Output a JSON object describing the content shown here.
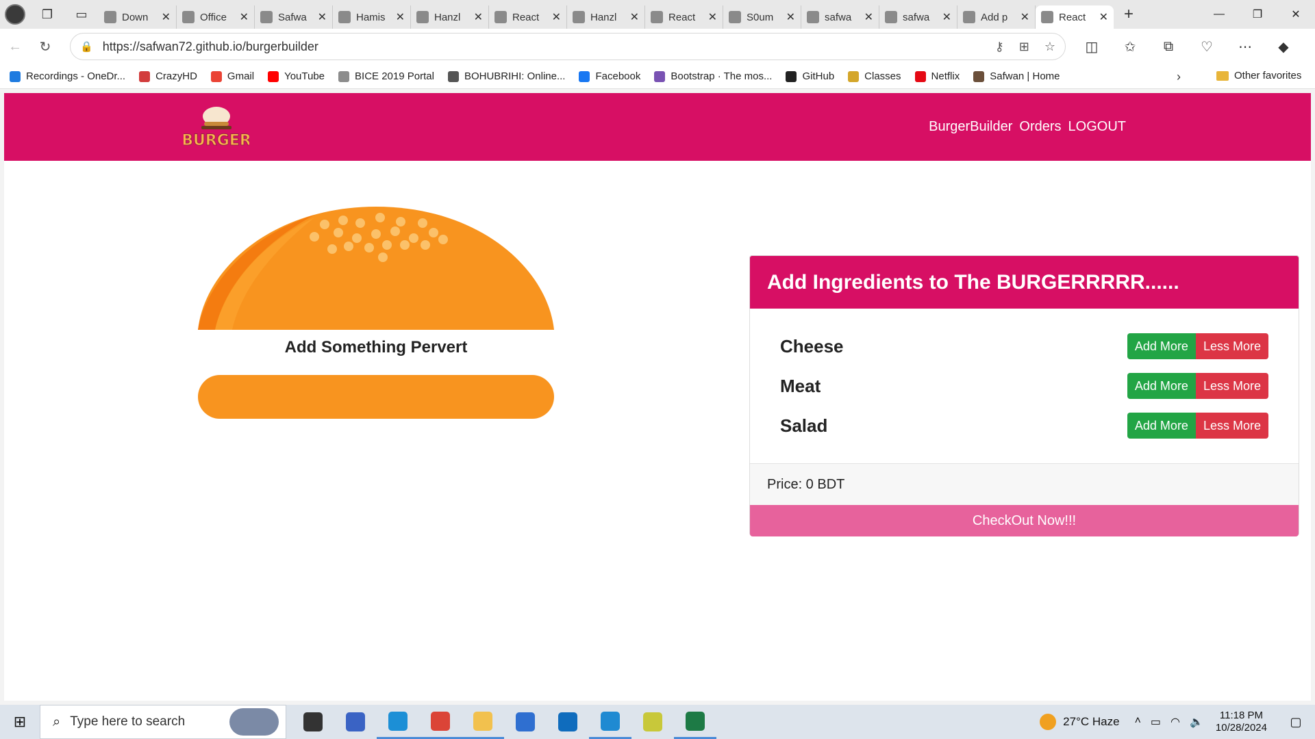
{
  "browser": {
    "tabs": [
      {
        "title": "Down",
        "icon": "gear-icon"
      },
      {
        "title": "Office",
        "icon": "document-icon"
      },
      {
        "title": "Safwa",
        "icon": "avatar-icon"
      },
      {
        "title": "Hamis",
        "icon": "wikipedia-icon"
      },
      {
        "title": "Hanzl",
        "icon": "code-icon"
      },
      {
        "title": "React",
        "icon": "vite-icon"
      },
      {
        "title": "Hanzl",
        "icon": "code-icon"
      },
      {
        "title": "React",
        "icon": "page-icon"
      },
      {
        "title": "S0um",
        "icon": "globe-icon"
      },
      {
        "title": "safwa",
        "icon": "github-icon"
      },
      {
        "title": "safwa",
        "icon": "github-icon"
      },
      {
        "title": "Add p",
        "icon": "page-icon"
      },
      {
        "title": "React",
        "icon": "react-icon",
        "active": true
      }
    ],
    "url": "https://safwan72.github.io/burgerbuilder",
    "bookmarks": [
      {
        "label": "Recordings - OneDr...",
        "color": "#1e7be0"
      },
      {
        "label": "CrazyHD",
        "color": "#d23c3c"
      },
      {
        "label": "Gmail",
        "color": "#ea4335"
      },
      {
        "label": "YouTube",
        "color": "#ff0000"
      },
      {
        "label": "BICE 2019 Portal",
        "color": "#8c8c8c"
      },
      {
        "label": "BOHUBRIHI: Online...",
        "color": "#555555"
      },
      {
        "label": "Facebook",
        "color": "#1877f2"
      },
      {
        "label": "Bootstrap · The mos...",
        "color": "#7952b3"
      },
      {
        "label": "GitHub",
        "color": "#222222"
      },
      {
        "label": "Classes",
        "color": "#d4a62a"
      },
      {
        "label": "Netflix",
        "color": "#e50914"
      },
      {
        "label": "Safwan | Home",
        "color": "#6b4f3a"
      }
    ],
    "other_favorites": "Other favorites"
  },
  "app": {
    "logo_text": "BURGER",
    "nav": [
      "BurgerBuilder",
      "Orders",
      "LOGOUT"
    ],
    "burger_message": "Add Something Pervert",
    "controls": {
      "title": "Add Ingredients to The BURGERRRRR......",
      "ingredients": [
        {
          "name": "Cheese",
          "add": "Add More",
          "less": "Less More"
        },
        {
          "name": "Meat",
          "add": "Add More",
          "less": "Less More"
        },
        {
          "name": "Salad",
          "add": "Add More",
          "less": "Less More"
        }
      ],
      "price": "Price: 0 BDT",
      "checkout": "CheckOut Now!!!"
    },
    "colors": {
      "brand": "#d70f64",
      "bread": "#f8941f",
      "add": "#22a545",
      "less": "#dc3545",
      "checkout": "#e7629c"
    }
  },
  "taskbar": {
    "search_placeholder": "Type here to search",
    "weather": "27°C  Haze",
    "time": "11:18 PM",
    "date": "10/28/2024",
    "apps": [
      {
        "name": "task-view-icon",
        "color": "#333333"
      },
      {
        "name": "app-icon",
        "color": "#3a63c4"
      },
      {
        "name": "edge-icon",
        "color": "#1c8fd6",
        "open": true
      },
      {
        "name": "chrome-icon",
        "color": "#db4437",
        "open": true
      },
      {
        "name": "file-explorer-icon",
        "color": "#f2c14e",
        "open": true
      },
      {
        "name": "store-icon",
        "color": "#2f6fd0"
      },
      {
        "name": "outlook-icon",
        "color": "#0f6cbd"
      },
      {
        "name": "vscode-icon",
        "color": "#1f8ad2",
        "open": true
      },
      {
        "name": "app-icon",
        "color": "#c8c83a"
      },
      {
        "name": "excel-icon",
        "color": "#1d7a45",
        "open": true
      }
    ]
  }
}
